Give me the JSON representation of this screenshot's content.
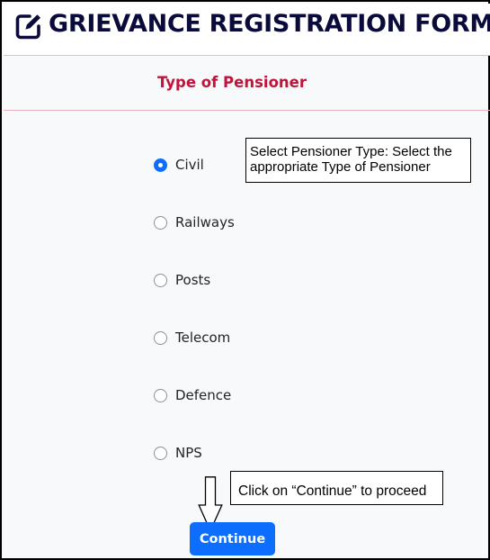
{
  "header": {
    "title": "GRIEVANCE REGISTRATION FORM",
    "icon": "edit-icon"
  },
  "form": {
    "section_title": "Type of Pensioner",
    "selected": "Civil",
    "options": [
      {
        "label": "Civil",
        "checked": true
      },
      {
        "label": "Railways",
        "checked": false
      },
      {
        "label": "Posts",
        "checked": false
      },
      {
        "label": "Telecom",
        "checked": false
      },
      {
        "label": "Defence",
        "checked": false
      },
      {
        "label": "NPS",
        "checked": false
      }
    ],
    "continue_label": "Continue"
  },
  "annotations": {
    "type_hint": "Select Pensioner Type: Select the appropriate Type of Pensioner",
    "continue_hint": "Click on “Continue” to proceed",
    "arrow_icon": "down-arrow-icon"
  },
  "colors": {
    "title": "#0b0b3b",
    "section_title": "#c0143c",
    "primary": "#0d6efd"
  }
}
